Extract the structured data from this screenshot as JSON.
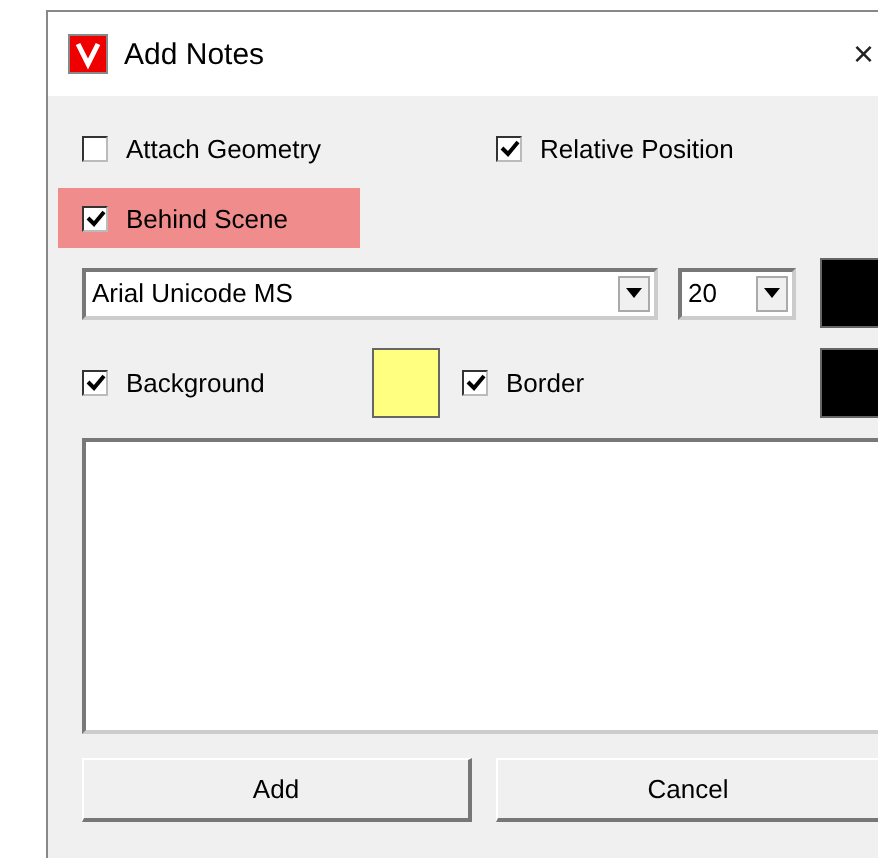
{
  "window": {
    "title": "Add Notes",
    "close": "×"
  },
  "options": [
    {
      "label": "Attach Geometry",
      "checked": false
    },
    {
      "label": "Relative Position",
      "checked": true
    }
  ],
  "behind_scene": {
    "label": "Behind Scene",
    "checked": true,
    "highlighted": true
  },
  "font": {
    "family": "Arial Unicode MS",
    "size": "20",
    "color": "#000000"
  },
  "background": {
    "label": "Background",
    "checked": true,
    "color": "#ffff80"
  },
  "border": {
    "label": "Border",
    "checked": true,
    "color": "#000000"
  },
  "buttons": [
    "Add",
    "Cancel"
  ]
}
